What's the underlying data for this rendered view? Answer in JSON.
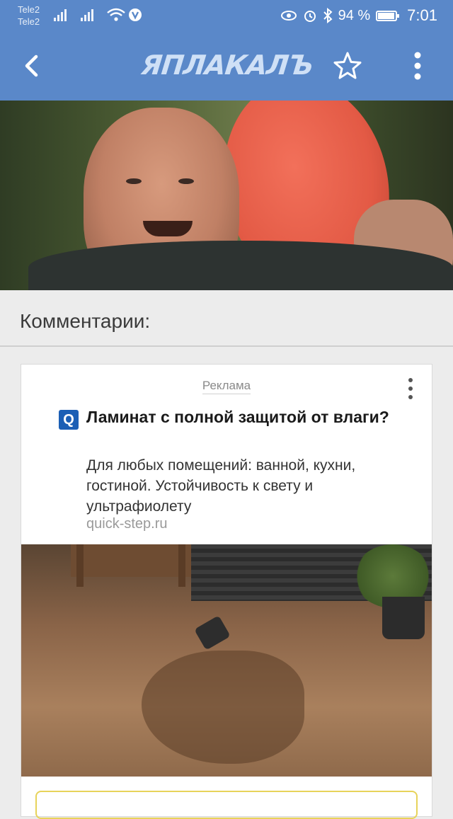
{
  "status_bar": {
    "carrier_1": "Tele2",
    "carrier_2": "Tele2",
    "battery_percent": "94 %",
    "time": "7:01"
  },
  "app_bar": {
    "logo_text": "ЯПЛАКАЛЪ",
    "back_icon": "chevron-left-icon",
    "favorite_icon": "star-outline-icon",
    "menu_icon": "more-vertical-icon"
  },
  "comments": {
    "title": "Комментарии:"
  },
  "ad": {
    "label": "Реклама",
    "favicon_letter": "Q",
    "title": "Ламинат с полной защитой от влаги?",
    "description": "Для любых помещений: ванной, кухни, гостиной. Устойчивость к свету и ультрафиолету",
    "domain": "quick-step.ru"
  },
  "colors": {
    "app_bar": "#5a88c9",
    "background": "#ececec",
    "ad_favicon": "#1c5fb5"
  }
}
